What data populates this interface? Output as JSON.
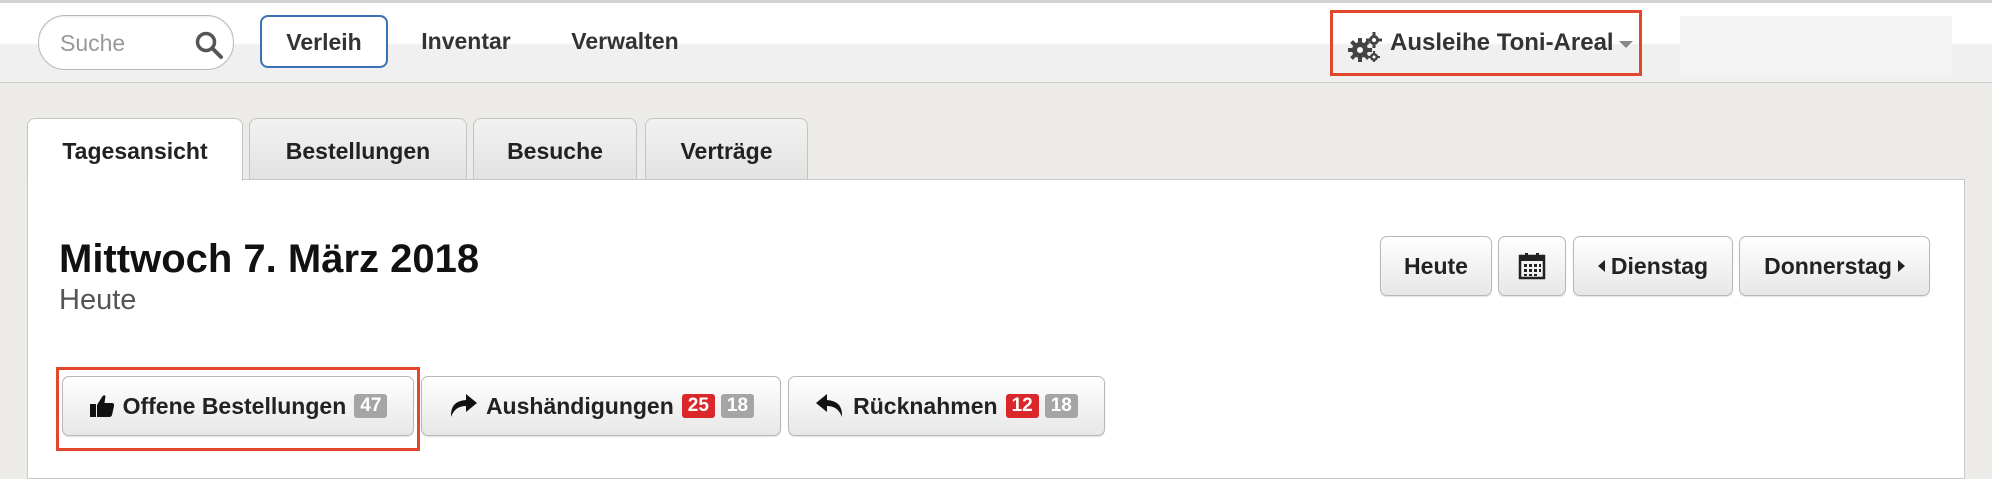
{
  "nav": {
    "search_placeholder": "Suche",
    "items": [
      {
        "label": "Verleih"
      },
      {
        "label": "Inventar"
      },
      {
        "label": "Verwalten"
      }
    ],
    "context": {
      "label": "Ausleihe Toni-Areal"
    }
  },
  "tabs": [
    {
      "label": "Tagesansicht"
    },
    {
      "label": "Bestellungen"
    },
    {
      "label": "Besuche"
    },
    {
      "label": "Verträge"
    }
  ],
  "day": {
    "title": "Mittwoch 7. März 2018",
    "subtitle": "Heute",
    "today_label": "Heute",
    "prev_label": "Dienstag",
    "next_label": "Donnerstag"
  },
  "actions": {
    "open_orders": {
      "label": "Offene Bestellungen",
      "count": "47"
    },
    "handovers": {
      "label": "Aushändigungen",
      "overdue": "25",
      "count": "18"
    },
    "returns": {
      "label": "Rücknahmen",
      "overdue": "12",
      "count": "18"
    }
  },
  "colors": {
    "accent": "#3b72b5",
    "highlight": "#e2462b",
    "danger": "#d9272a"
  },
  "icons": [
    "search-icon",
    "gears-icon",
    "calendar-icon",
    "thumbs-up-icon",
    "share-icon",
    "reply-icon"
  ]
}
